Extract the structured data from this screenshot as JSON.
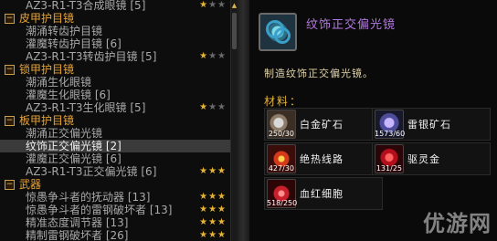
{
  "list": {
    "rows": [
      {
        "type": "item",
        "label": "AZ3-R1-T3合成眼镜 [5]",
        "stars": 1
      },
      {
        "type": "category",
        "label": "皮甲护目镜"
      },
      {
        "type": "item",
        "label": "潮涌转齿护目镜"
      },
      {
        "type": "item",
        "label": "灌魔转齿护目镜 [6]"
      },
      {
        "type": "item",
        "label": "AZ3-R1-T3转齿护目镜 [5]",
        "stars": 1
      },
      {
        "type": "category",
        "label": "锁甲护目镜"
      },
      {
        "type": "item",
        "label": "潮涌生化眼镜"
      },
      {
        "type": "item",
        "label": "灌魔生化眼镜 [6]"
      },
      {
        "type": "item",
        "label": "AZ3-R1-T3生化眼镜 [5]",
        "stars": 1
      },
      {
        "type": "category",
        "label": "板甲护目镜"
      },
      {
        "type": "item",
        "label": "潮涌正交偏光镜"
      },
      {
        "type": "item",
        "label": "纹饰正交偏光镜 [2]",
        "selected": true
      },
      {
        "type": "item",
        "label": "灌魔正交偏光镜 [6]"
      },
      {
        "type": "item",
        "label": "AZ3-R1-T3正交偏光镜 [6]",
        "stars": 3
      },
      {
        "type": "category",
        "label": "武器"
      },
      {
        "type": "item",
        "label": "惊愚争斗者的抚动器 [13]",
        "stars": 3
      },
      {
        "type": "item",
        "label": "惊愚争斗者的雷钢破坏者 [13]",
        "stars": 3
      },
      {
        "type": "item",
        "label": "精准态度调节器 [13]",
        "stars": 3
      },
      {
        "type": "item",
        "label": "精制雷钢破坏者 [26]",
        "stars": 3
      }
    ]
  },
  "detail": {
    "icon": "goggles-icon",
    "title": "纹饰正交偏光镜",
    "description": "制造纹饰正交偏光镜。",
    "materials_header": "材料：",
    "materials": [
      {
        "name": "白金矿石",
        "count": "250/30",
        "icon": "platinum-ore-icon"
      },
      {
        "name": "雷银矿石",
        "count": "1573/60",
        "icon": "storm-silver-ore-icon"
      },
      {
        "name": "绝热线路",
        "count": "427/30",
        "icon": "insulated-wiring-icon"
      },
      {
        "name": "驱灵金",
        "count": "131/25",
        "icon": "monelite-ore-icon"
      },
      {
        "name": "血红细胞",
        "count": "518/250",
        "icon": "blood-cell-icon"
      }
    ]
  },
  "watermark": "优游网",
  "colors": {
    "category": "#e8a336",
    "item": "#a9a9a9",
    "title_epic": "#b278e0",
    "star_on": "#e8b32d",
    "star_off": "#6a6a6a"
  }
}
